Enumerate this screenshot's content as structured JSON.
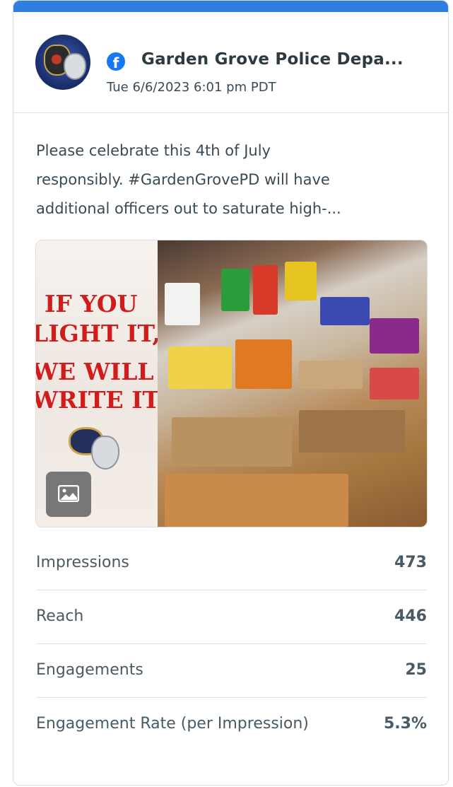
{
  "header": {
    "page_name": "Garden Grove Police Depa...",
    "date": "Tue 6/6/2023 6:01 pm PDT",
    "network_icon": "facebook-icon",
    "network_glyph": "f"
  },
  "post": {
    "text_lines": [
      "Please celebrate this 4th of July",
      "responsibly. #GardenGrovePD will have",
      "additional officers out to saturate high-..."
    ]
  },
  "media": {
    "slogan_lines": [
      "IF YOU",
      "LIGHT IT,",
      "WE WILL",
      "WRITE IT."
    ],
    "type_icon": "image-icon"
  },
  "metrics": [
    {
      "label": "Impressions",
      "value": "473"
    },
    {
      "label": "Reach",
      "value": "446"
    },
    {
      "label": "Engagements",
      "value": "25"
    },
    {
      "label": "Engagement Rate (per Impression)",
      "value": "5.3%"
    }
  ],
  "colors": {
    "accent": "#2d7ee0",
    "facebook": "#1877f2",
    "slogan_red": "#d01c1c"
  }
}
